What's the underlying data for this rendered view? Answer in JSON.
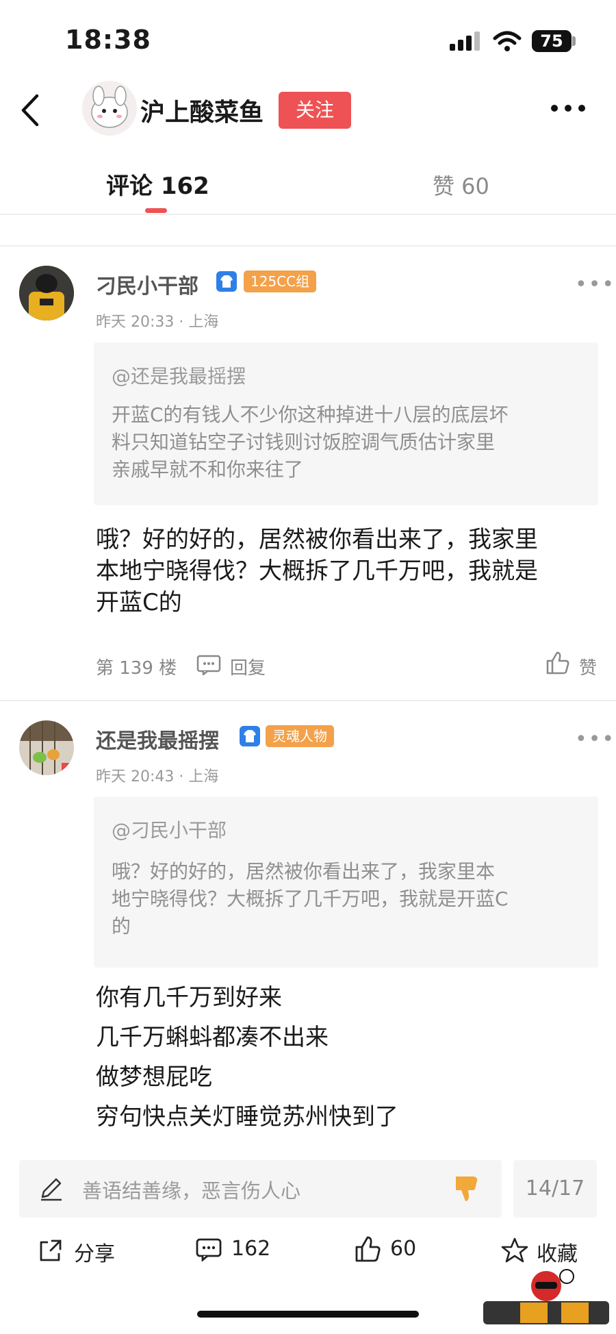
{
  "status_bar": {
    "time": "18:38",
    "battery": "75"
  },
  "header": {
    "title": "沪上酸菜鱼",
    "follow_label": "关注"
  },
  "tabs": {
    "comments": "评论 162",
    "likes": "赞 60"
  },
  "comments": [
    {
      "username": "刁民小干部",
      "tag": "125CC组",
      "meta": "昨天 20:33 · 上海",
      "quote_user": "@还是我最摇摆",
      "quote_text": "开蓝C的有钱人不少你这种掉进十八层的底层坏\n料只知道钻空子讨钱则讨饭腔调气质估计家里\n亲戚早就不和你来往了",
      "body": "哦？好的好的，居然被你看出来了，我家里\n本地宁晓得伐？大概拆了几千万吧，我就是\n开蓝C的",
      "floor": "第 139 楼",
      "reply_label": "回复",
      "like_label": "赞"
    },
    {
      "username": "还是我最摇摆",
      "tag": "灵魂人物",
      "meta": "昨天 20:43 · 上海",
      "quote_user": "@刁民小干部",
      "quote_text": "哦？好的好的，居然被你看出来了，我家里本\n地宁晓得伐？大概拆了几千万吧，我就是开蓝C\n的",
      "body": "你有几千万到好来\n几千万蝌蚪都凑不出来\n做梦想屁吃\n穷句快点关灯睡觉苏州快到了"
    }
  ],
  "input": {
    "placeholder": "善语结善缘，恶言伤人心",
    "page": "14/17"
  },
  "bottom_bar": {
    "share": "分享",
    "comments": "162",
    "likes": "60",
    "favorite": "收藏"
  },
  "colors": {
    "accent": "#ee5254",
    "tag": "#f3a14a",
    "vip": "#2f7fe8"
  }
}
